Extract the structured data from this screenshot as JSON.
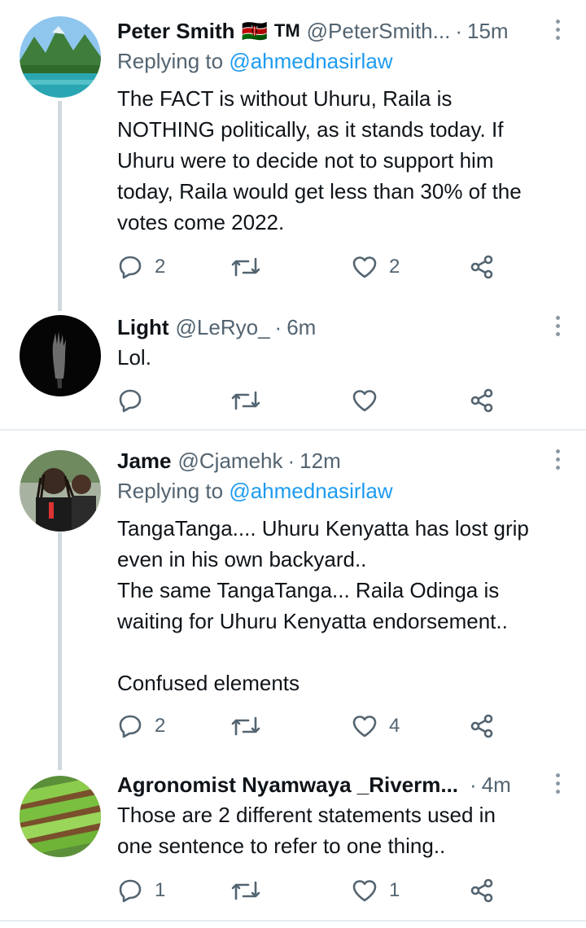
{
  "colors": {
    "link": "#1d9bf0",
    "muted": "#536471",
    "text": "#0f1419",
    "line": "#cfd9de"
  },
  "tweets": [
    {
      "name": "Peter Smith",
      "flag": "🇰🇪",
      "badge": "TM",
      "handle": "@PeterSmith...",
      "time": "15m",
      "replying_prefix": "Replying to ",
      "replying_to": "@ahmednasirlaw",
      "lines": [
        "The FACT is without Uhuru, Raila is",
        "NOTHING politically, as it stands today. If",
        "Uhuru were to decide not to support him",
        "today, Raila would get less than 30% of the",
        "votes come 2022."
      ],
      "replies": "2",
      "retweets": "",
      "likes": "2",
      "avatar": "mountain-lake-landscape"
    },
    {
      "name": "Light",
      "handle": "@LeRyo_",
      "time": "6m",
      "lines": [
        "Lol."
      ],
      "replies": "",
      "retweets": "",
      "likes": "",
      "avatar": "dark-hand-silhouette"
    },
    {
      "name": "Jame",
      "handle": "@Cjamehk",
      "time": "12m",
      "replying_prefix": "Replying to ",
      "replying_to": "@ahmednasirlaw",
      "lines": [
        "TangaTanga.... Uhuru Kenyatta has lost grip",
        "even in his own backyard..",
        "The same TangaTanga... Raila Odinga is",
        "waiting for Uhuru Kenyatta endorsement..",
        "",
        "Confused elements"
      ],
      "replies": "2",
      "retweets": "",
      "likes": "4",
      "avatar": "crowd-photo"
    },
    {
      "name": "Agronomist Nyamwaya _Riverm...",
      "time": "4m",
      "lines": [
        "Those are 2 different statements used in",
        "one sentence to refer to one thing.."
      ],
      "replies": "1",
      "retweets": "",
      "likes": "1",
      "avatar": "seedling-trays"
    }
  ]
}
